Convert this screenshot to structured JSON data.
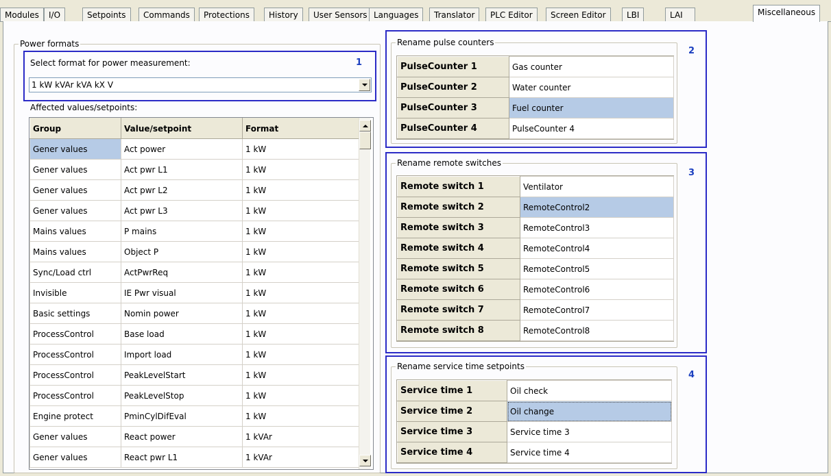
{
  "tabs": [
    "Modules",
    "I/O",
    "Setpoints",
    "Commands",
    "Protections",
    "History",
    "User Sensors",
    "Languages",
    "Translator",
    "PLC Editor",
    "Screen Editor",
    "LBI",
    "LAI",
    "Miscellaneous"
  ],
  "active_tab": "Miscellaneous",
  "power_formats": {
    "legend": "Power formats",
    "marker": "1",
    "select_label": "Select format for power measurement:",
    "selected_format": "1 kW kVAr kVA kX V",
    "affected_label": "Affected values/setpoints:",
    "columns": [
      "Group",
      "Value/setpoint",
      "Format"
    ],
    "rows": [
      [
        "Gener values",
        "Act power",
        "1 kW"
      ],
      [
        "Gener values",
        "Act pwr L1",
        "1 kW"
      ],
      [
        "Gener values",
        "Act pwr L2",
        "1 kW"
      ],
      [
        "Gener values",
        "Act pwr L3",
        "1 kW"
      ],
      [
        "Mains values",
        "P mains",
        "1 kW"
      ],
      [
        "Mains values",
        "Object P",
        "1 kW"
      ],
      [
        "Sync/Load ctrl",
        "ActPwrReq",
        "1 kW"
      ],
      [
        "Invisible",
        "IE Pwr visual",
        "1 kW"
      ],
      [
        "Basic settings",
        "Nomin power",
        "1 kW"
      ],
      [
        "ProcessControl",
        "Base load",
        "1 kW"
      ],
      [
        "ProcessControl",
        "Import load",
        "1 kW"
      ],
      [
        "ProcessControl",
        "PeakLevelStart",
        "1 kW"
      ],
      [
        "ProcessControl",
        "PeakLevelStop",
        "1 kW"
      ],
      [
        "Engine protect",
        "PminCylDifEval",
        "1 kW"
      ],
      [
        "Gener values",
        "React power",
        "1 kVAr"
      ],
      [
        "Gener values",
        "React pwr L1",
        "1 kVAr"
      ]
    ]
  },
  "pulse_counters": {
    "legend": "Rename pulse counters",
    "marker": "2",
    "rows": [
      [
        "PulseCounter 1",
        "Gas counter"
      ],
      [
        "PulseCounter 2",
        "Water counter"
      ],
      [
        "PulseCounter 3",
        "Fuel counter"
      ],
      [
        "PulseCounter 4",
        "PulseCounter 4"
      ]
    ]
  },
  "remote_switches": {
    "legend": "Rename remote switches",
    "marker": "3",
    "rows": [
      [
        "Remote switch 1",
        "Ventilator"
      ],
      [
        "Remote switch 2",
        "RemoteControl2"
      ],
      [
        "Remote switch 3",
        "RemoteControl3"
      ],
      [
        "Remote switch 4",
        "RemoteControl4"
      ],
      [
        "Remote switch 5",
        "RemoteControl5"
      ],
      [
        "Remote switch 6",
        "RemoteControl6"
      ],
      [
        "Remote switch 7",
        "RemoteControl7"
      ],
      [
        "Remote switch 8",
        "RemoteControl8"
      ]
    ]
  },
  "service_time": {
    "legend": "Rename service time setpoints",
    "marker": "4",
    "rows": [
      [
        "Service time 1",
        "Oil check"
      ],
      [
        "Service time 2",
        "Oil change"
      ],
      [
        "Service time 3",
        "Service time 3"
      ],
      [
        "Service time 4",
        "Service time 4"
      ]
    ]
  },
  "colors": {
    "selection": "#b6cbe6",
    "marker_box": "#2a2ac6",
    "marker_text": "#1b3fbf"
  },
  "icons": [
    "chevron-down-icon",
    "scroll-up-icon",
    "scroll-down-icon"
  ]
}
